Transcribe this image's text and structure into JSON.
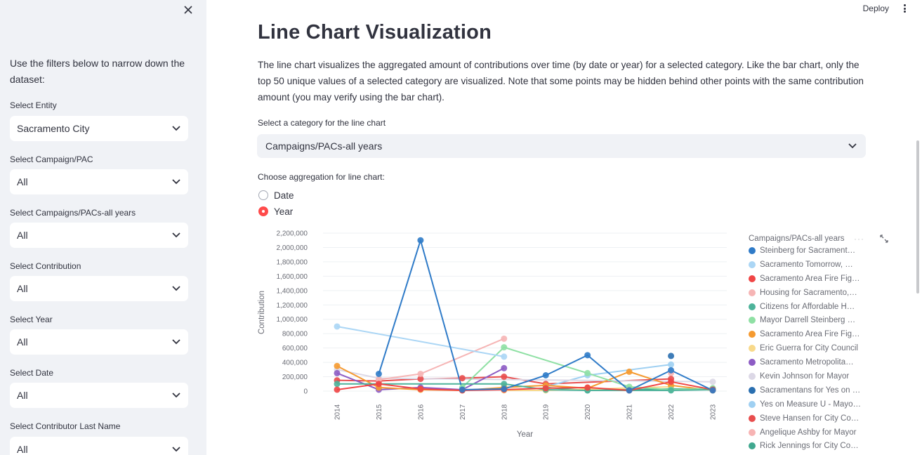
{
  "sidebar": {
    "intro": "Use the filters below to narrow down the dataset:",
    "filters": [
      {
        "label": "Select Entity",
        "value": "Sacramento City"
      },
      {
        "label": "Select Campaign/PAC",
        "value": "All"
      },
      {
        "label": "Select Campaigns/PACs-all years",
        "value": "All"
      },
      {
        "label": "Select Contribution",
        "value": "All"
      },
      {
        "label": "Select Year",
        "value": "All"
      },
      {
        "label": "Select Date",
        "value": "All"
      },
      {
        "label": "Select Contributor Last Name",
        "value": "All"
      }
    ]
  },
  "header": {
    "deploy": "Deploy"
  },
  "main": {
    "title": "Line Chart Visualization",
    "description": "The line chart visualizes the aggregated amount of contributions over time (by date or year) for a selected category. Like the bar chart, only the top 50 unique values of a selected category are visualized. Note that some points may be hidden behind other points with the same contribution amount (you may verify using the bar chart).",
    "category_label": "Select a category for the line chart",
    "category_value": "Campaigns/PACs-all years",
    "aggregation_label": "Choose aggregation for line chart:",
    "aggregation_options": [
      "Date",
      "Year"
    ],
    "aggregation_selected": "Year"
  },
  "chart_data": {
    "type": "line",
    "xlabel": "Year",
    "ylabel": "Contribution",
    "legend_title": "Campaigns/PACs-all years",
    "ylim": [
      0,
      2200000
    ],
    "yticks": [
      "2,200,000",
      "2,000,000",
      "1,800,000",
      "1,600,000",
      "1,400,000",
      "1,200,000",
      "1,000,000",
      "800,000",
      "600,000",
      "400,000",
      "200,000",
      "0"
    ],
    "categories": [
      "2014",
      "2015",
      "2016",
      "2017",
      "2018",
      "2019",
      "2020",
      "2021",
      "2022",
      "2023"
    ],
    "series": [
      {
        "name": "Steinberg for Sacrament…",
        "color": "#2f7bc8",
        "values": [
          null,
          240000,
          2100000,
          20000,
          30000,
          220000,
          500000,
          10000,
          290000,
          10000
        ]
      },
      {
        "name": "Sacramento Tomorrow, …",
        "color": "#abd6f5",
        "values": [
          900000,
          null,
          null,
          null,
          480000,
          null,
          null,
          null,
          null,
          null
        ]
      },
      {
        "name": "Sacramento Area Fire Fig…",
        "color": "#f04545",
        "values": [
          20000,
          100000,
          30000,
          10000,
          20000,
          40000,
          50000,
          10000,
          130000,
          20000
        ]
      },
      {
        "name": "Housing for Sacramento,…",
        "color": "#f6b5b5",
        "values": [
          null,
          160000,
          240000,
          null,
          730000,
          null,
          null,
          null,
          null,
          null
        ]
      },
      {
        "name": "Citizens for Affordable H…",
        "color": "#4db39a",
        "values": [
          100000,
          null,
          null,
          null,
          100000,
          20000,
          10000,
          10000,
          10000,
          20000
        ]
      },
      {
        "name": "Mayor Darrell Steinberg …",
        "color": "#8fe0a4",
        "values": [
          null,
          null,
          null,
          50000,
          610000,
          null,
          250000,
          60000,
          20000,
          40000
        ]
      },
      {
        "name": "Sacramento Area Fire Fig…",
        "color": "#f59a30",
        "values": [
          350000,
          50000,
          20000,
          10000,
          50000,
          80000,
          40000,
          270000,
          80000,
          10000
        ]
      },
      {
        "name": "Eric Guerra for City Council",
        "color": "#f8d98a",
        "values": [
          null,
          null,
          null,
          null,
          10000,
          10000,
          null,
          null,
          60000,
          null
        ]
      },
      {
        "name": "Sacramento Metropolita…",
        "color": "#8d5cc4",
        "values": [
          250000,
          20000,
          50000,
          20000,
          320000,
          null,
          null,
          null,
          null,
          null
        ]
      },
      {
        "name": "Kevin Johnson for Mayor",
        "color": "#dcd8e6",
        "values": [
          300000,
          180000,
          null,
          null,
          null,
          null,
          null,
          null,
          null,
          130000
        ]
      },
      {
        "name": "Sacramentans for Yes on …",
        "color": "#2a6fb0",
        "values": [
          null,
          null,
          null,
          null,
          null,
          null,
          null,
          null,
          490000,
          null
        ]
      },
      {
        "name": "Yes on Measure U - Mayo…",
        "color": "#9fd0f2",
        "values": [
          null,
          null,
          null,
          null,
          null,
          60000,
          220000,
          null,
          370000,
          null
        ]
      },
      {
        "name": "Steve Hansen for City Co…",
        "color": "#e84d4d",
        "values": [
          150000,
          140000,
          170000,
          180000,
          200000,
          100000,
          null,
          null,
          170000,
          null
        ]
      },
      {
        "name": "Angelique Ashby for Mayor",
        "color": "#f7b4b4",
        "values": [
          null,
          null,
          null,
          null,
          null,
          null,
          null,
          null,
          250000,
          null
        ]
      },
      {
        "name": "Rick Jennings for City Co…",
        "color": "#40a88f",
        "values": [
          null,
          null,
          null,
          null,
          null,
          50000,
          10000,
          20000,
          30000,
          30000
        ]
      }
    ]
  }
}
